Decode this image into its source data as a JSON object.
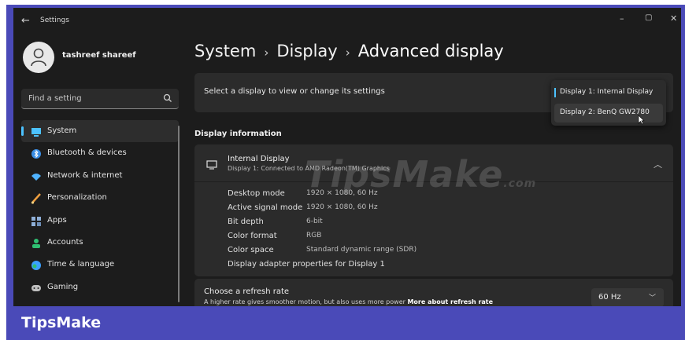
{
  "window": {
    "title": "Settings",
    "controls": {
      "minimize": "–",
      "maximize": "▢",
      "close": "✕"
    }
  },
  "user": {
    "name": "tashreef shareef"
  },
  "search": {
    "placeholder": "Find a setting"
  },
  "sidebar": {
    "items": [
      {
        "label": "System",
        "icon": "system-icon",
        "color": "#4cc2ff",
        "selected": true
      },
      {
        "label": "Bluetooth & devices",
        "icon": "bluetooth-icon",
        "color": "#3a8ee6"
      },
      {
        "label": "Network & internet",
        "icon": "wifi-icon",
        "color": "#4fb3ff"
      },
      {
        "label": "Personalization",
        "icon": "brush-icon",
        "color": "#f0a040"
      },
      {
        "label": "Apps",
        "icon": "apps-icon",
        "color": "#8fb0d8"
      },
      {
        "label": "Accounts",
        "icon": "accounts-icon",
        "color": "#2fbf71"
      },
      {
        "label": "Time & language",
        "icon": "globe-icon",
        "color": "#3aa0ff"
      },
      {
        "label": "Gaming",
        "icon": "gaming-icon",
        "color": "#c0c0c0"
      }
    ]
  },
  "breadcrumb": {
    "part1": "System",
    "part2": "Display",
    "current": "Advanced display",
    "separator": "›"
  },
  "display_select": {
    "label": "Select a display to view or change its settings",
    "options": [
      "Display 1: Internal Display",
      "Display 2: BenQ GW2780"
    ]
  },
  "display_info": {
    "section_title": "Display information",
    "name": "Internal Display",
    "subtitle": "Display 1: Connected to AMD Radeon(TM) Graphics",
    "rows": [
      {
        "label": "Desktop mode",
        "value": "1920 × 1080, 60 Hz"
      },
      {
        "label": "Active signal mode",
        "value": "1920 × 1080, 60 Hz"
      },
      {
        "label": "Bit depth",
        "value": "6-bit"
      },
      {
        "label": "Color format",
        "value": "RGB"
      },
      {
        "label": "Color space",
        "value": "Standard dynamic range (SDR)"
      }
    ],
    "adapter_link": "Display adapter properties for Display 1"
  },
  "refresh": {
    "title": "Choose a refresh rate",
    "desc": "A higher rate gives smoother motion, but also uses more power",
    "link": "More about refresh rate",
    "value": "60 Hz"
  },
  "watermark": {
    "text": "TipsMake",
    "suffix": ".com"
  },
  "footer": {
    "brand": "TipsMake"
  },
  "colors": {
    "accent": "#4cc2ff",
    "frame": "#4a4ab8",
    "window_bg": "#1c1c1c",
    "card_bg": "#2b2b2b"
  }
}
